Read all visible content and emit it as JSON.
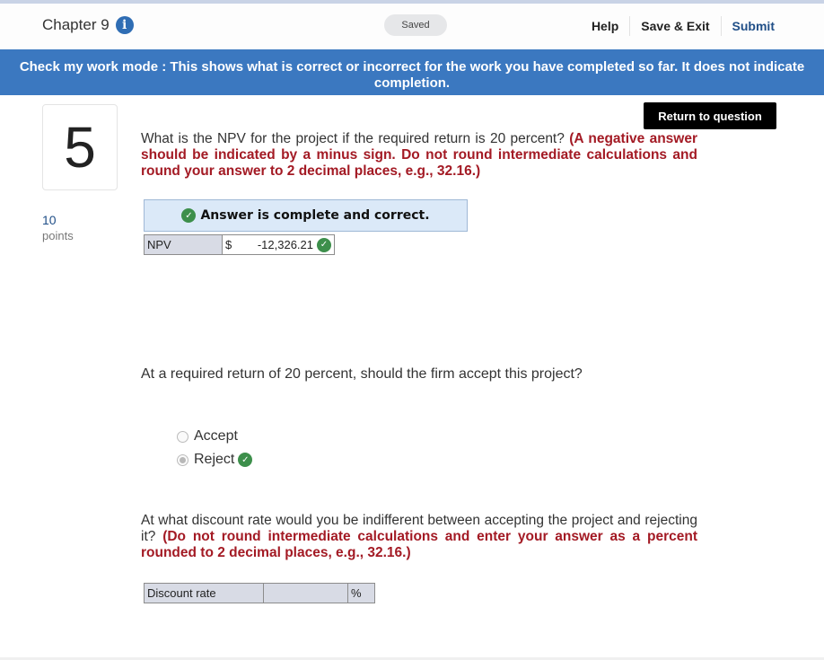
{
  "header": {
    "chapter_title": "Chapter 9",
    "info_icon": "info-icon",
    "saved_status": "Saved",
    "nav": {
      "help": "Help",
      "save_exit": "Save & Exit",
      "submit": "Submit"
    }
  },
  "banner": {
    "text": "Check my work mode : This shows what is correct or incorrect for the work you have completed so far. It does not indicate completion."
  },
  "question": {
    "number": "5",
    "points_value": "10",
    "points_label": "points",
    "return_button": "Return to question"
  },
  "part1": {
    "prompt": "What is the NPV for the project if the required return is 20 percent?",
    "instruction": "(A negative answer should be indicated by a minus sign. Do not round intermediate calculations and round your answer to 2 decimal places, e.g., 32.16.)",
    "result_banner": "Answer is complete and correct.",
    "row_label": "NPV",
    "currency": "$",
    "value": "-12,326.21",
    "status_icon": "check-icon"
  },
  "part2": {
    "prompt": "At a required return of 20 percent, should the firm accept this project?",
    "options": [
      {
        "label": "Accept",
        "selected": false
      },
      {
        "label": "Reject",
        "selected": true,
        "correct": true
      }
    ]
  },
  "part3": {
    "prompt": "At what discount rate would you be indifferent between accepting the project and rejecting it?",
    "instruction": "(Do not round intermediate calculations and enter your answer as a percent rounded to 2 decimal places, e.g., 32.16.)",
    "row_label": "Discount rate",
    "value": "",
    "unit": "%"
  },
  "colors": {
    "banner_blue": "#3b78c0",
    "instruction_red": "#a31a24",
    "correct_green": "#3d8f4b",
    "submit_blue": "#1f4e87"
  }
}
